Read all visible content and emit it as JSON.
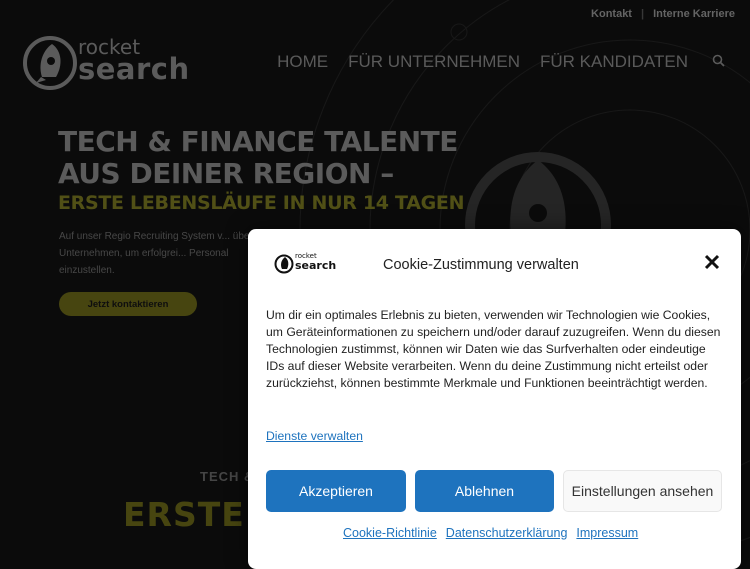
{
  "topbar": {
    "links": [
      "Kontakt",
      "Interne Karriere"
    ]
  },
  "logo": {
    "line1": "rocket",
    "line2": "search"
  },
  "nav": {
    "items": [
      "HOME",
      "FÜR UNTERNEHMEN",
      "FÜR KANDIDATEN"
    ],
    "search_icon": "search-icon"
  },
  "hero": {
    "headline_line1": "TECH & FINANCE TALENTE",
    "headline_line2": "AUS DEINER REGION –",
    "subheadline": "ERSTE LEBENSLÄUFE IN NUR 14 TAGEN",
    "paragraph": "Auf unser Regio Recruiting System v... über 100 Unternehmen, um erfolgrei... Personal einzustellen.",
    "cta": "Jetzt kontaktieren"
  },
  "section": {
    "kicker": "TECH &",
    "heading": "ERSTE L"
  },
  "cookie": {
    "logo_line1": "rocket",
    "logo_line2": "search",
    "title": "Cookie-Zustimmung verwalten",
    "text": "Um dir ein optimales Erlebnis zu bieten, verwenden wir Technologien wie Cookies, um Geräteinformationen zu speichern und/oder darauf zuzugreifen. Wenn du diesen Technologien zustimmst, können wir Daten wie das Surfverhalten oder eindeutige IDs auf dieser Website verarbeiten. Wenn du deine Zustimmung nicht erteilst oder zurückziehst, können bestimmte Merkmale und Funktionen beeinträchtigt werden.",
    "manage_link": "Dienste verwalten",
    "accept": "Akzeptieren",
    "deny": "Ablehnen",
    "settings": "Einstellungen ansehen",
    "links": [
      "Cookie-Richtlinie",
      "Datenschutzerklärung",
      "Impressum"
    ]
  },
  "colors": {
    "accent_blue": "#1e73be",
    "brand_olive": "#7d7b22",
    "background": "#121212"
  }
}
